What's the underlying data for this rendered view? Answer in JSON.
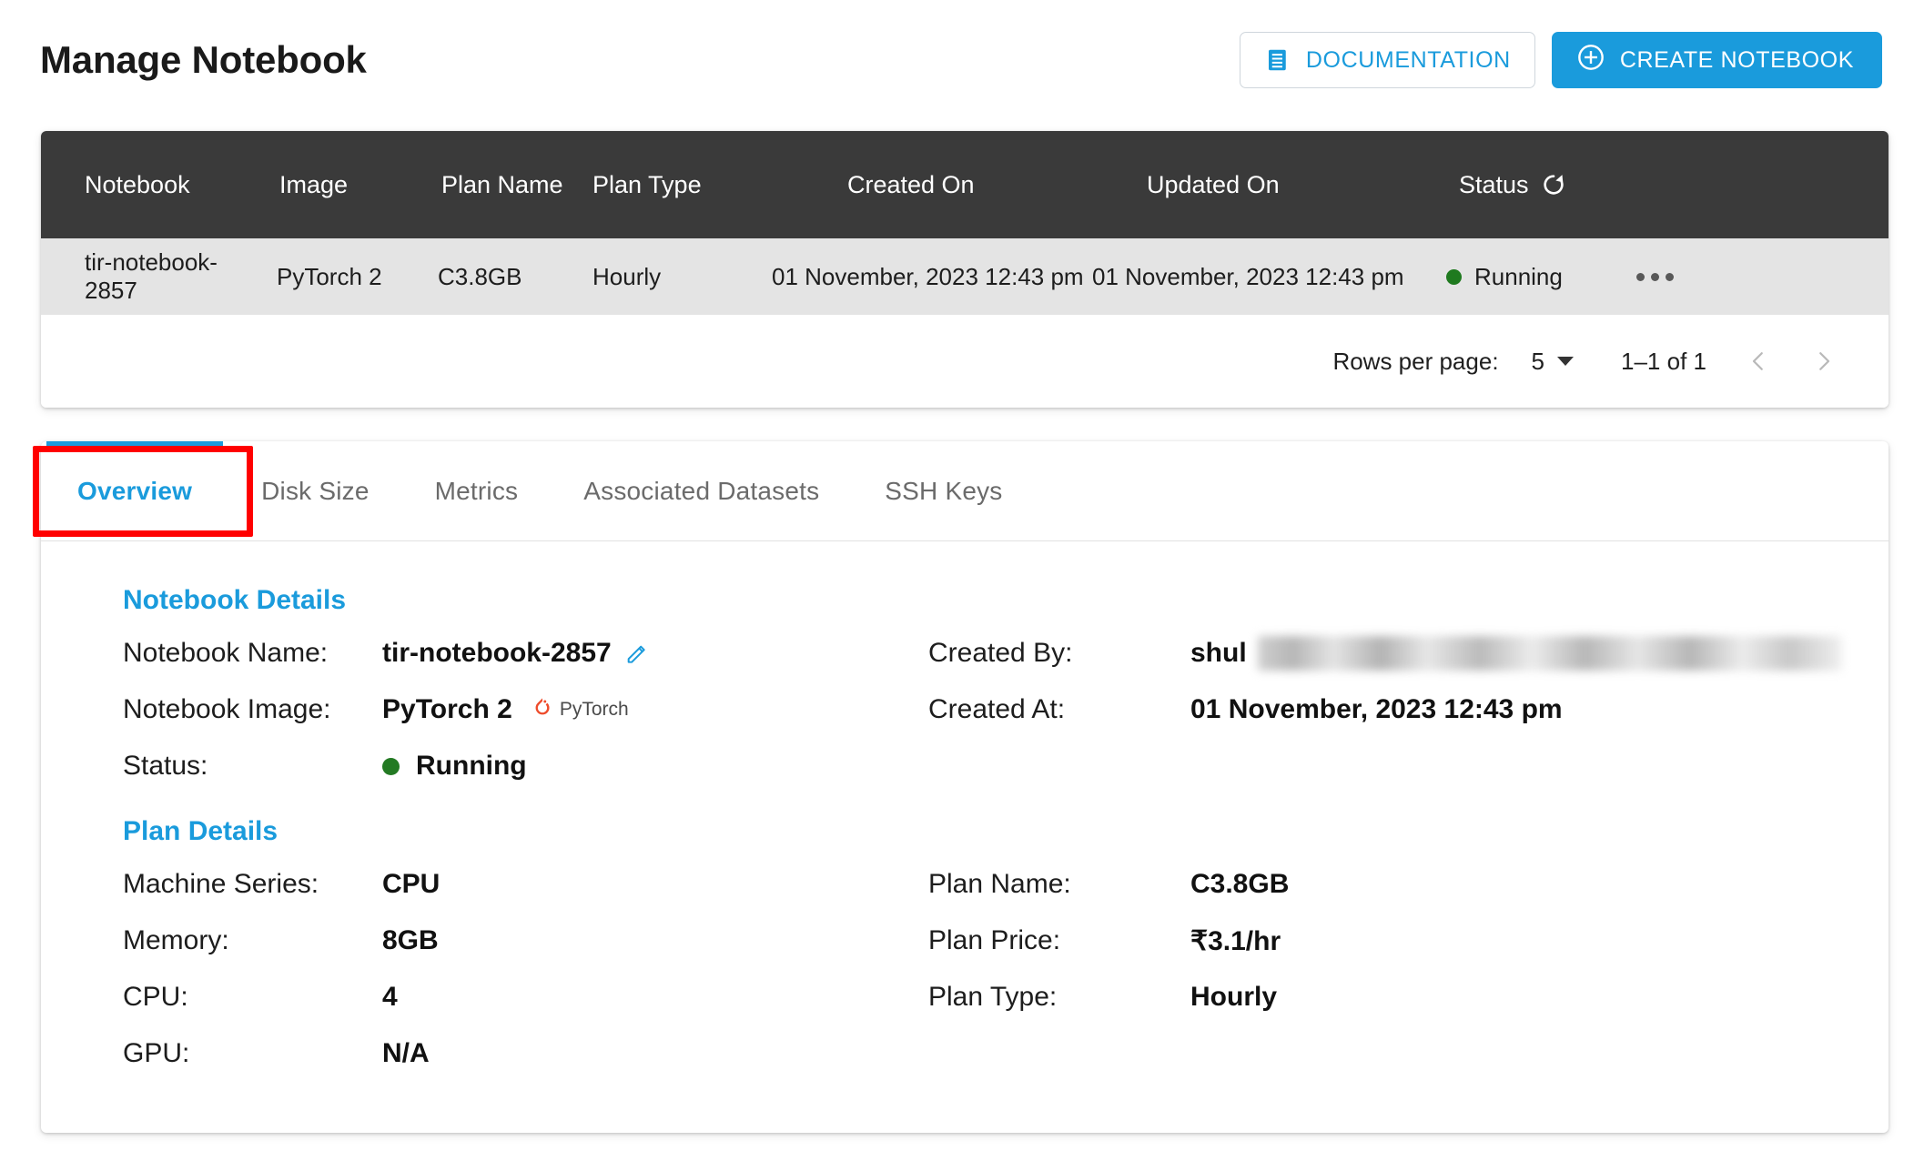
{
  "header": {
    "title": "Manage Notebook",
    "documentation_label": "DOCUMENTATION",
    "create_label": "CREATE NOTEBOOK",
    "doc_icon": "document-icon",
    "create_icon": "plus-circle-icon",
    "accent_color": "#1A9BDC"
  },
  "table": {
    "columns": [
      "Notebook",
      "Image",
      "Plan Name",
      "Plan Type",
      "Created On",
      "Updated On",
      "Status"
    ],
    "refresh_icon": "refresh-icon",
    "rows": [
      {
        "notebook": "tir-notebook-2857",
        "image": "PyTorch 2",
        "plan_name": "C3.8GB",
        "plan_type": "Hourly",
        "created_on": "01 November, 2023 12:43 pm",
        "updated_on": "01 November, 2023 12:43 pm",
        "status": "Running",
        "status_color": "#1F7A1F",
        "actions_icon": "more-options-icon"
      }
    ],
    "pagination": {
      "rows_per_page_label": "Rows per page:",
      "rows_per_page_value": "5",
      "range": "1–1 of 1",
      "prev_icon": "chevron-left-icon",
      "next_icon": "chevron-right-icon"
    }
  },
  "tabs": {
    "items": [
      {
        "label": "Overview",
        "active": true
      },
      {
        "label": "Disk Size",
        "active": false
      },
      {
        "label": "Metrics",
        "active": false
      },
      {
        "label": "Associated Datasets",
        "active": false
      },
      {
        "label": "SSH Keys",
        "active": false
      }
    ],
    "highlight_color": "#FF0000"
  },
  "overview": {
    "notebook_details": {
      "title": "Notebook Details",
      "left": [
        {
          "key": "Notebook Name:",
          "value": "tir-notebook-2857",
          "icon": "edit-pencil-icon"
        },
        {
          "key": "Notebook Image:",
          "value": "PyTorch 2",
          "icon": "pytorch-logo-icon",
          "badge_text": "PyTorch"
        },
        {
          "key": "Status:",
          "value": "Running",
          "icon": "status-dot-icon",
          "status_color": "#237A23"
        }
      ],
      "right": [
        {
          "key": "Created By:",
          "value": "shul",
          "redacted": true
        },
        {
          "key": "Created At:",
          "value": "01 November, 2023 12:43 pm"
        }
      ]
    },
    "plan_details": {
      "title": "Plan Details",
      "left": [
        {
          "key": "Machine Series:",
          "value": "CPU"
        },
        {
          "key": "Memory:",
          "value": "8GB"
        },
        {
          "key": "CPU:",
          "value": "4"
        },
        {
          "key": "GPU:",
          "value": "N/A"
        }
      ],
      "right": [
        {
          "key": "Plan Name:",
          "value": "C3.8GB"
        },
        {
          "key": "Plan Price:",
          "value": "₹3.1/hr"
        },
        {
          "key": "Plan Type:",
          "value": "Hourly"
        }
      ]
    }
  }
}
